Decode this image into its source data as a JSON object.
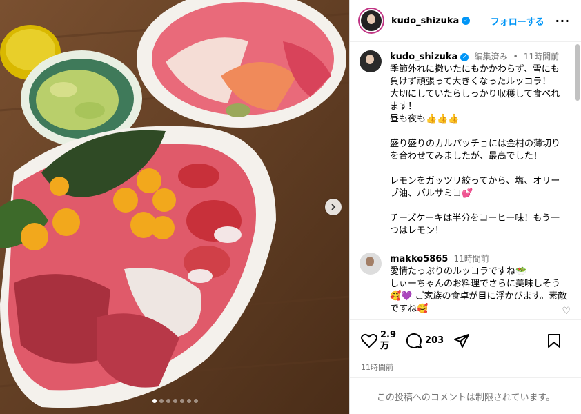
{
  "header": {
    "username": "kudo_shizuka",
    "follow_label": "フォローする",
    "more_icon": "more-horizontal-icon"
  },
  "post": {
    "username": "kudo_shizuka",
    "edited_label": "編集済み",
    "separator": "•",
    "time": "11時間前",
    "caption": "季節外れに撒いたにもかかわらず、雪にも負けず頑張って大きくなったルッコラ！　大切にしていたらしっかり収穫して食べれます！\n昼も夜も👍👍👍\n\n盛り盛りのカルパッチョには金柑の薄切りを合わせてみましたが、最高でした！\n\nレモンをガッツリ絞ってから、塩、オリーブ油、バルサミコ💕\n\nチーズケーキは半分をコーヒー味！もう一つはレモン！"
  },
  "comments": [
    {
      "username": "makko5865",
      "time": "11時間前",
      "text": "愛情たっぷりのルッコラですね🥗\nしぃーちゃんのお料理でさらに美味しそう🥰💜 ご家族の食卓が目に浮かびます。素敵ですね🥰"
    }
  ],
  "actions": {
    "likes": "2.9\n万",
    "comments_count": "203",
    "time_ago": "11時間前"
  },
  "footer": {
    "comments_disabled": "この投稿へのコメントは制限されています。"
  },
  "carousel": {
    "slide_count": 7,
    "active_index": 0
  },
  "colors": {
    "accent": "#0095f6",
    "ring": "#c13584"
  }
}
